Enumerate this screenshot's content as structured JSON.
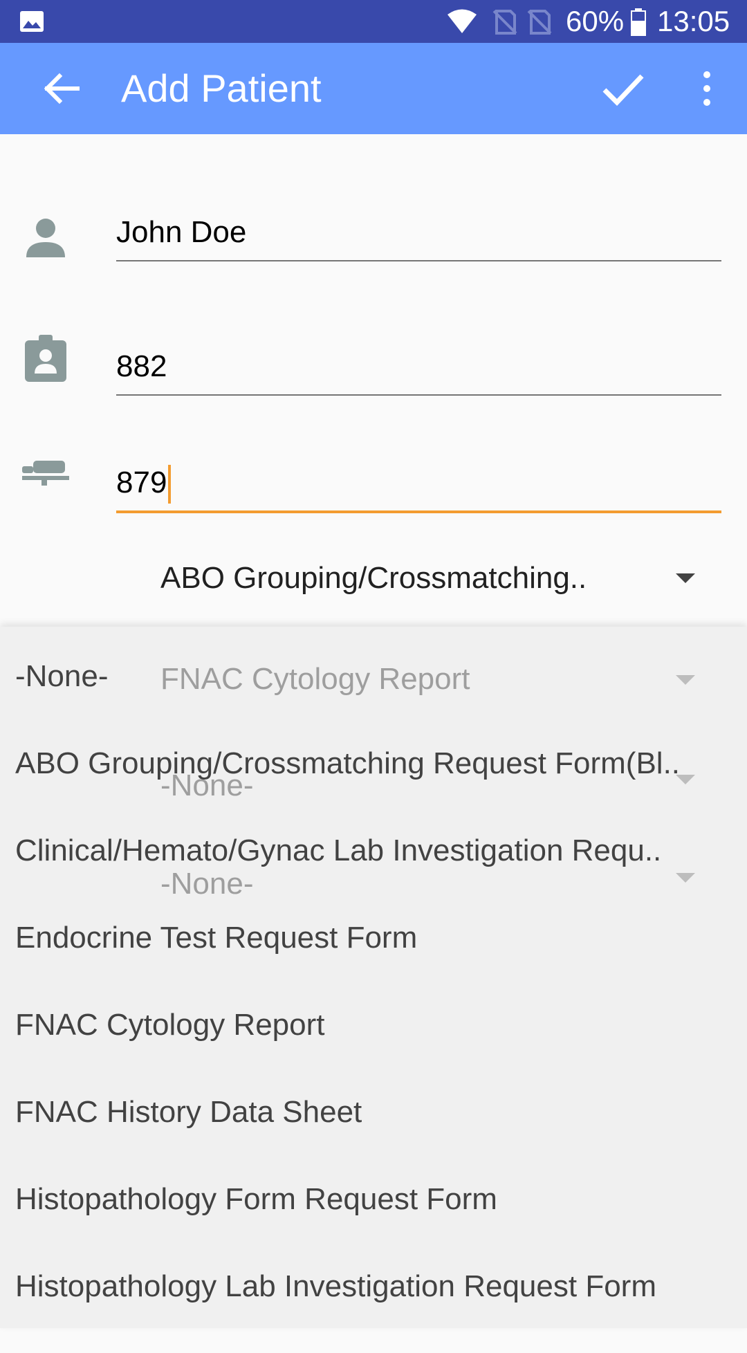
{
  "status_bar": {
    "battery_percent": "60%",
    "time": "13:05",
    "icons": [
      "gallery-icon",
      "wifi-icon",
      "no-sim-icon",
      "no-sim-icon",
      "battery-icon"
    ]
  },
  "app_bar": {
    "title": "Add Patient",
    "back_icon": "arrow-left-icon",
    "confirm_icon": "check-icon",
    "more_icon": "more-vert-icon"
  },
  "form": {
    "name_value": "John Doe",
    "id_value": "882",
    "bed_value": "879",
    "selected_form": "ABO Grouping/Crossmatching..",
    "underlying_spinners": [
      {
        "value": "FNAC Cytology Report"
      },
      {
        "value": "-None-"
      },
      {
        "value": "-None-"
      }
    ]
  },
  "dropdown": {
    "items": [
      "-None-",
      "ABO Grouping/Crossmatching Request Form(Bl..",
      "Clinical/Hemato/Gynac Lab Investigation Requ..",
      "Endocrine Test Request Form",
      "FNAC Cytology Report",
      "FNAC History Data Sheet",
      "Histopathology Form Request Form",
      "Histopathology Lab Investigation Request Form"
    ]
  },
  "colors": {
    "status_bar": "#3949ab",
    "app_bar": "#6699ff",
    "accent": "#f39c30"
  }
}
